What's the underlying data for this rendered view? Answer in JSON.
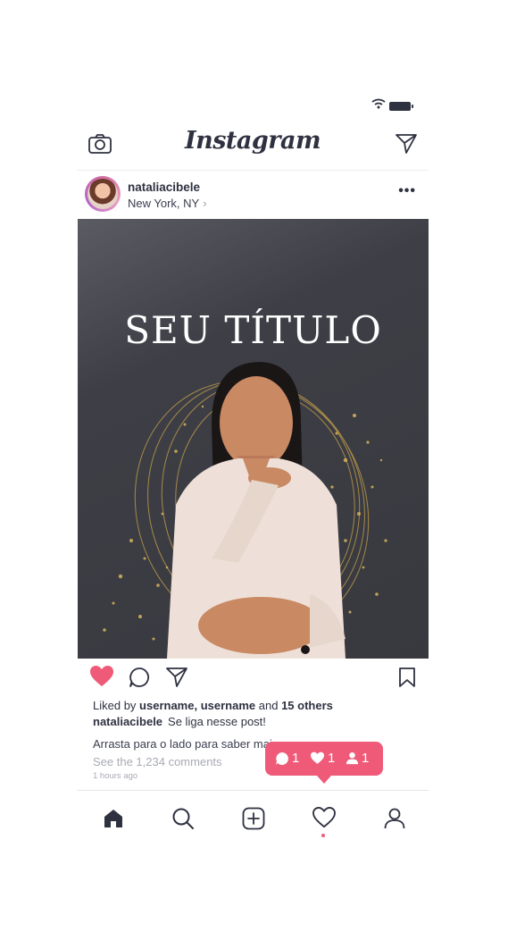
{
  "header": {
    "logo": "Instagram"
  },
  "post": {
    "username": "nataliacibele",
    "location": "New York, NY",
    "image_title": "SEU TÍTULO",
    "likes_prefix": "Liked by",
    "likes_users": "username, username",
    "likes_and": "and",
    "likes_others": "15 others",
    "caption_user": "nataliacibele",
    "caption_text": "Se liga nesse post!",
    "caption_more": "Arrasta para o lado para saber mais",
    "comments_link": "See the 1,234 comments",
    "time_ago": "1 hours ago"
  },
  "notification": {
    "comments": "1",
    "likes": "1",
    "follows": "1"
  },
  "colors": {
    "accent": "#ef5a78",
    "text": "#2e3140",
    "photo_bg": "#3e3f46",
    "gold": "#c9a24b"
  }
}
